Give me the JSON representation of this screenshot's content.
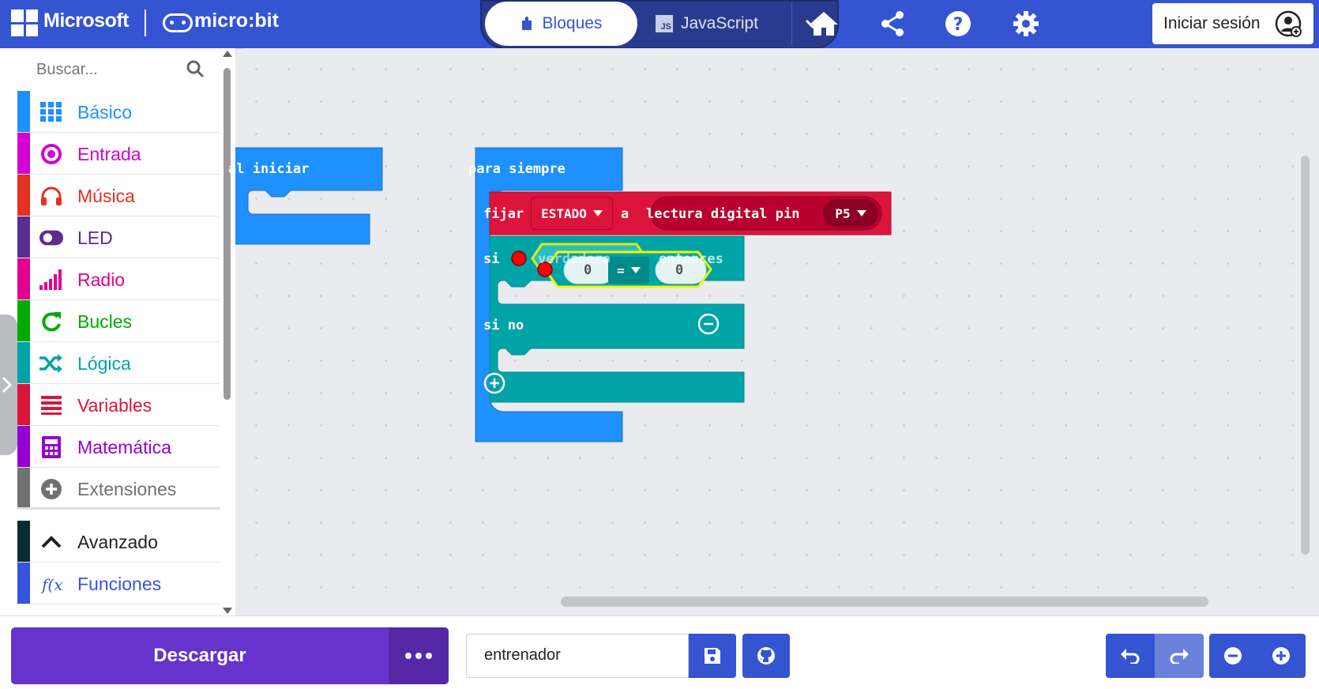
{
  "header": {
    "brand": "Microsoft",
    "product": "micro:bit",
    "tabs": {
      "blocks": "Bloques",
      "javascript": "JavaScript",
      "js_badge": "JS"
    },
    "signin": "Iniciar sesión"
  },
  "toolbox": {
    "search_placeholder": "Buscar...",
    "categories": [
      {
        "label": "Básico",
        "color": "#1e90ff",
        "icon": "grid-icon"
      },
      {
        "label": "Entrada",
        "color": "#d400d4",
        "icon": "circle-target-icon"
      },
      {
        "label": "Música",
        "color": "#e63022",
        "icon": "headphones-icon"
      },
      {
        "label": "LED",
        "color": "#5c2d91",
        "icon": "toggle-icon"
      },
      {
        "label": "Radio",
        "color": "#e3008c",
        "icon": "signal-bars-icon"
      },
      {
        "label": "Bucles",
        "color": "#00aa00",
        "icon": "refresh-icon"
      },
      {
        "label": "Lógica",
        "color": "#00a4a6",
        "icon": "shuffle-icon"
      },
      {
        "label": "Variables",
        "color": "#dc143c",
        "icon": "list-icon"
      },
      {
        "label": "Matemática",
        "color": "#9400d3",
        "icon": "calculator-icon"
      },
      {
        "label": "Extensiones",
        "color": "#717171",
        "icon": "plus-circle-icon"
      },
      {
        "label": "Avanzado",
        "color": "#0a2b33",
        "icon": "chevron-up-icon"
      },
      {
        "label": "Funciones",
        "color": "#3455db",
        "icon": "function-icon"
      }
    ]
  },
  "blocks": {
    "on_start": "al iniciar",
    "forever": "para siempre",
    "set": "fijar",
    "variable": "ESTADO",
    "to": "a",
    "digital_read": "lectura digital pin",
    "pin": "P5",
    "if": "si",
    "true_text": "verdadero",
    "then": "entonces",
    "else": "si no",
    "left_value": "0",
    "operator": "=",
    "right_value": "0"
  },
  "footer": {
    "download": "Descargar",
    "project_name": "entrenador"
  },
  "colors": {
    "header": "#3454d1",
    "download": "#6633cc",
    "loops_blue": "#1e90ff",
    "logic_teal": "#00a4a6",
    "variables_red": "#dc143c",
    "pins_red": "#b8002e"
  }
}
